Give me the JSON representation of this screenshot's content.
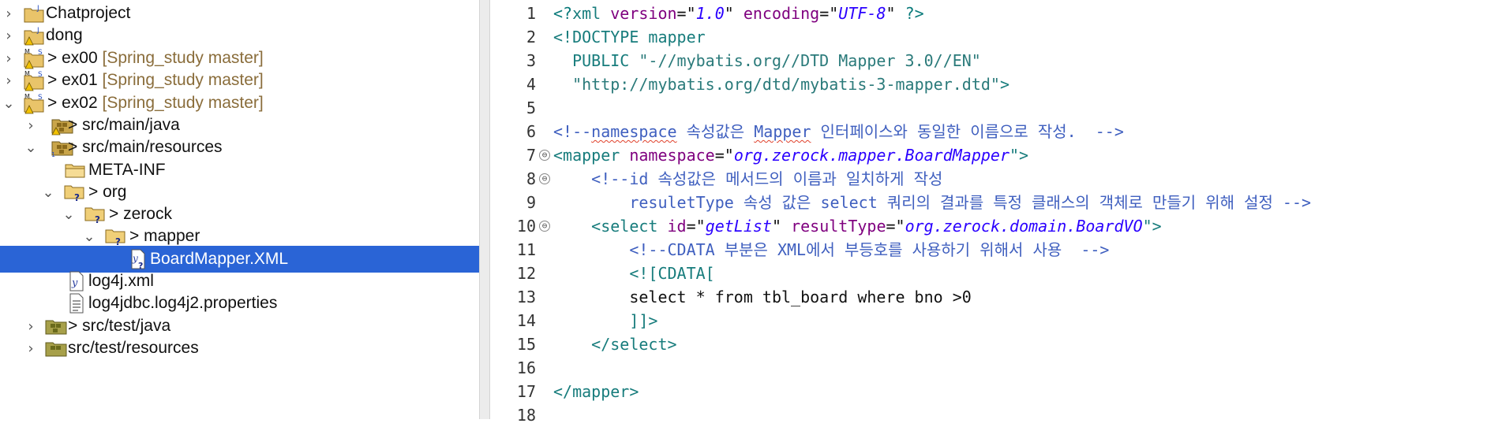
{
  "colors": {
    "selection": "#2a64d6",
    "git_decoration": "#8a6d3b",
    "xml_tag": "#177c7c",
    "xml_attr": "#7f007f",
    "xml_value": "#2a00ff",
    "xml_comment": "#3f5fbf"
  },
  "tree": {
    "items": [
      {
        "label": "Chatproject",
        "prefix": "",
        "decoration": "",
        "icon": "java-project-icon",
        "chevron": "›"
      },
      {
        "label": "dong",
        "prefix": "",
        "decoration": "",
        "icon": "java-project-warning-icon",
        "chevron": "›"
      },
      {
        "label": "ex00",
        "prefix": "> ",
        "decoration": "[Spring_study master]",
        "icon": "maven-project-warning-icon",
        "chevron": "›"
      },
      {
        "label": "ex01",
        "prefix": "> ",
        "decoration": "[Spring_study master]",
        "icon": "maven-project-warning-icon",
        "chevron": "›"
      },
      {
        "label": "ex02",
        "prefix": "> ",
        "decoration": "[Spring_study master]",
        "icon": "maven-project-warning-icon",
        "chevron": "⌄"
      },
      {
        "label": "src/main/java",
        "prefix": "> ",
        "decoration": "",
        "icon": "source-folder-icon",
        "chevron": "›"
      },
      {
        "label": "src/main/resources",
        "prefix": "> ",
        "decoration": "",
        "icon": "source-folder-icon",
        "chevron": "⌄"
      },
      {
        "label": "META-INF",
        "prefix": "",
        "decoration": "",
        "icon": "folder-icon",
        "chevron": ""
      },
      {
        "label": "org",
        "prefix": "> ",
        "decoration": "",
        "icon": "untracked-folder-icon",
        "chevron": "⌄"
      },
      {
        "label": "zerock",
        "prefix": "> ",
        "decoration": "",
        "icon": "untracked-folder-icon",
        "chevron": "⌄"
      },
      {
        "label": "mapper",
        "prefix": "> ",
        "decoration": "",
        "icon": "untracked-folder-icon",
        "chevron": "⌄"
      },
      {
        "label": "BoardMapper.XML",
        "prefix": "",
        "decoration": "",
        "icon": "xml-file-untracked-icon",
        "chevron": "",
        "selected": true
      },
      {
        "label": "log4j.xml",
        "prefix": "",
        "decoration": "",
        "icon": "xml-file-icon",
        "chevron": ""
      },
      {
        "label": "log4jdbc.log4j2.properties",
        "prefix": "",
        "decoration": "",
        "icon": "properties-file-icon",
        "chevron": ""
      },
      {
        "label": "src/test/java",
        "prefix": "> ",
        "decoration": "",
        "icon": "source-folder-icon",
        "chevron": "›"
      },
      {
        "label": "src/test/resources",
        "prefix": "",
        "decoration": "",
        "icon": "source-folder-icon",
        "chevron": "›"
      }
    ]
  },
  "editor": {
    "line_numbers": [
      "1",
      "2",
      "3",
      "4",
      "5",
      "6",
      "7",
      "8",
      "9",
      "10",
      "11",
      "12",
      "13",
      "14",
      "15",
      "16",
      "17",
      "18"
    ],
    "fold_markers": [
      "⊖",
      "⊖",
      "⊖"
    ],
    "code": {
      "l1": {
        "a": "<?",
        "b": "xml",
        "c": " version",
        "d": "=\"",
        "e": "1.0",
        "f": "\"",
        "g": " encoding",
        "h": "=\"",
        "i": "UTF-8",
        "j": "\"",
        "k": " ?>"
      },
      "l2": {
        "a": "<!DOCTYPE mapper"
      },
      "l3": {
        "a": "  PUBLIC ",
        "b": "\"-//mybatis.org//DTD Mapper 3.0//EN\""
      },
      "l4": {
        "a": "  ",
        "b": "\"http://mybatis.org/dtd/mybatis-3-mapper.dtd\"",
        "c": ">"
      },
      "l6": {
        "a": "<!--",
        "b": "namespace",
        "c": " 속성값은 ",
        "d": "Mapper",
        "e": " 인터페이스와 동일한 이름으로 작성.  -->"
      },
      "l7": {
        "a": "<",
        "b": "mapper",
        "c": " namespace",
        "d": "=\"",
        "e": "org.zerock.mapper.BoardMapper",
        "f": "\">"
      },
      "l8": {
        "a": "    <!--id 속성값은 메서드의 이름과 일치하게 작성"
      },
      "l9": {
        "a": "        resuletType 속성 값은 select 쿼리의 결과를 특정 클래스의 객체로 만들기 위해 설정 -->"
      },
      "l10": {
        "a": "    <",
        "b": "select",
        "c": " id",
        "d": "=\"",
        "e": "getList",
        "f": "\"",
        "g": " resultType",
        "h": "=\"",
        "i": "org.zerock.domain.BoardVO",
        "j": "\">"
      },
      "l11": {
        "a": "        <!--CDATA 부분은 XML에서 부등호를 사용하기 위해서 사용  -->"
      },
      "l12": {
        "a": "        <![CDATA["
      },
      "l13": {
        "a": "        select * from tbl_board where bno >0"
      },
      "l14": {
        "a": "        ]]>"
      },
      "l15": {
        "a": "    </",
        "b": "select",
        "c": ">"
      },
      "l17": {
        "a": "</",
        "b": "mapper",
        "c": ">"
      }
    }
  }
}
